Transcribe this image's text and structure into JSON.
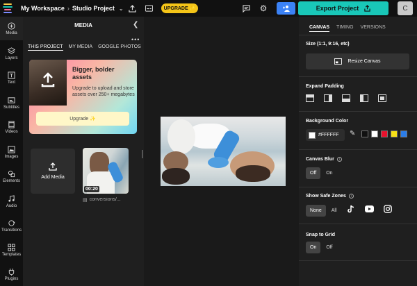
{
  "topbar": {
    "workspace": "My Workspace",
    "separator": "›",
    "project": "Studio Project",
    "upgrade_label": "UPGRADE ✨",
    "export_label": "Export Project",
    "avatar_initial": "C"
  },
  "rail": [
    {
      "label": "Media",
      "icon": "media-icon",
      "active": true
    },
    {
      "label": "Layers",
      "icon": "layers-icon"
    },
    {
      "label": "Text",
      "icon": "text-icon"
    },
    {
      "label": "Subtitles",
      "icon": "subtitles-icon"
    },
    {
      "label": "Videos",
      "icon": "videos-icon"
    },
    {
      "label": "Images",
      "icon": "images-icon"
    },
    {
      "label": "Elements",
      "icon": "elements-icon"
    },
    {
      "label": "Audio",
      "icon": "audio-icon"
    },
    {
      "label": "Transitions",
      "icon": "transitions-icon"
    },
    {
      "label": "Templates",
      "icon": "templates-icon"
    },
    {
      "label": "Plugins",
      "icon": "plugins-icon"
    }
  ],
  "media": {
    "title": "MEDIA",
    "tabs": [
      "THIS PROJECT",
      "MY MEDIA",
      "GOOGLE PHOTOS"
    ],
    "promo": {
      "heading": "Bigger, bolder assets",
      "subtext": "Upgrade to upload and store assets over 250+ megabytes",
      "button": "Upgrade ✨"
    },
    "add_media": "Add Media",
    "item": {
      "duration": "00:20",
      "name": "conversions/..."
    }
  },
  "right": {
    "tabs": [
      "CANVAS",
      "TIMING",
      "VERSIONS"
    ],
    "size_label": "Size (1:1, 9:16, etc)",
    "resize_button": "Resize Canvas",
    "expand_label": "Expand Padding",
    "bg_label": "Background Color",
    "bg_value": "#FFFFFF",
    "swatch_colors": [
      "#111111",
      "#ffffff",
      "#e8112d",
      "#f7e017",
      "#2b7de9"
    ],
    "blur_label": "Canvas Blur",
    "blur_off": "Off",
    "blur_on": "On",
    "safe_label": "Show Safe Zones",
    "safe_none": "None",
    "safe_all": "All",
    "snap_label": "Snap to Grid",
    "snap_on": "On",
    "snap_off": "Off"
  },
  "colors": {
    "accent": "#19c7b8",
    "blue": "#3b82f6",
    "upgrade": "#f5c518"
  }
}
